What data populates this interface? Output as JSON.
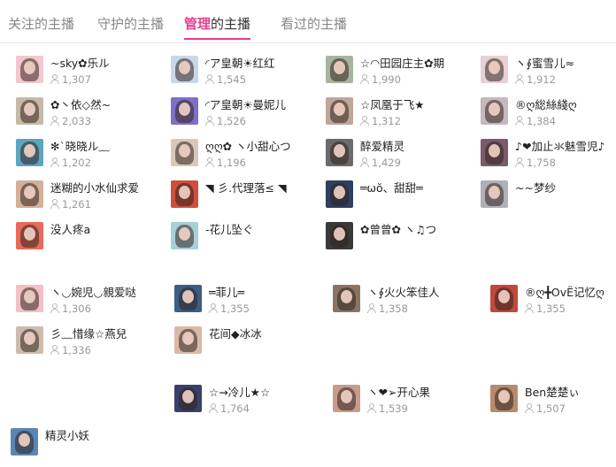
{
  "tabs": [
    {
      "label": "关注的主播"
    },
    {
      "label_highlight": "管理",
      "label_rest": "的主播"
    },
    {
      "label": "守护的主播"
    },
    {
      "label": "看过的主播"
    }
  ],
  "users": [
    {
      "name": "~sky✿乐ル",
      "count": "1,307"
    },
    {
      "name": "◜ア皇朝☀红红",
      "count": "1,545"
    },
    {
      "name": "☆◠田园庄主✿期",
      "count": "1,990"
    },
    {
      "name": "ヽ∮蜜雪儿≈",
      "count": "1,912"
    },
    {
      "name": "✿丶依◇然~",
      "count": "2,033"
    },
    {
      "name": "◜ア皇朝☀曼妮儿",
      "count": "1,526"
    },
    {
      "name": "☆凤凰于飞★",
      "count": "1,312"
    },
    {
      "name": "®ღ総絲綫ღ",
      "count": "1,384"
    },
    {
      "name": "✻`晓晓ル﹏",
      "count": "1,202"
    },
    {
      "name": "ღღ✿ ヽ小甜心つ",
      "count": "1,196"
    },
    {
      "name": "醉爱精灵",
      "count": "1,429"
    },
    {
      "name": "♪❤加止氺魅雪児♪",
      "count": "1,758"
    },
    {
      "name": "迷糊的小水仙求爱",
      "count": "1,261"
    },
    {
      "name": "◥ 彡.代理落≤ ◥",
      "count": ""
    },
    {
      "name": "═ωŏ、甜甜═",
      "count": ""
    },
    {
      "name": "~~梦纱",
      "count": ""
    },
    {
      "name": "没人疼a",
      "count": ""
    },
    {
      "name": "-花儿坠ぐ",
      "count": ""
    },
    {
      "name": "✿曾曾✿ ヽ♫つ",
      "count": ""
    },
    {
      "name": "ヽ◡婉児◡親爱哒",
      "count": "1,306"
    },
    {
      "name": "═菲儿═",
      "count": "1,355"
    },
    {
      "name": "ヽ∮火火笨佳人",
      "count": "1,358"
    },
    {
      "name": "®ღ╋OvЁ记忆ღ",
      "count": "1,355"
    },
    {
      "name": "彡﹏惜缘☆燕兒",
      "count": "1,336"
    },
    {
      "name": "花间◆冰冰",
      "count": ""
    },
    {
      "name": "☆→冷儿★☆",
      "count": "1,764"
    },
    {
      "name": "ヽ❤➢开心果",
      "count": "1,539"
    },
    {
      "name": "Ben楚楚ぃ",
      "count": "1,507"
    },
    {
      "name": "精灵小妖",
      "count": ""
    }
  ],
  "colors": {
    "accent": "#e5408f",
    "avatars": [
      "#f3c7cf",
      "#c9d8e8",
      "#a8b4a0",
      "#e8d0d6",
      "#c6b9a8",
      "#7f6fc7",
      "#bfa69a",
      "#c7b7bf",
      "#5ea5bf",
      "#d8c8b8",
      "#6b6b6b",
      "#7c5a6e",
      "#d3b09a",
      "#ce4f3c",
      "#2f3f5f",
      "#b0b0b8",
      "#e86a5a",
      "#a8d0d8",
      "#3a3a3a",
      "#f4c0c8",
      "#3c5d86",
      "#8a7565",
      "#c0493f",
      "#cdbcae",
      "#d9b9a8",
      "#39406b",
      "#c79c8a",
      "#b58d6e",
      "#5a86b5"
    ]
  }
}
